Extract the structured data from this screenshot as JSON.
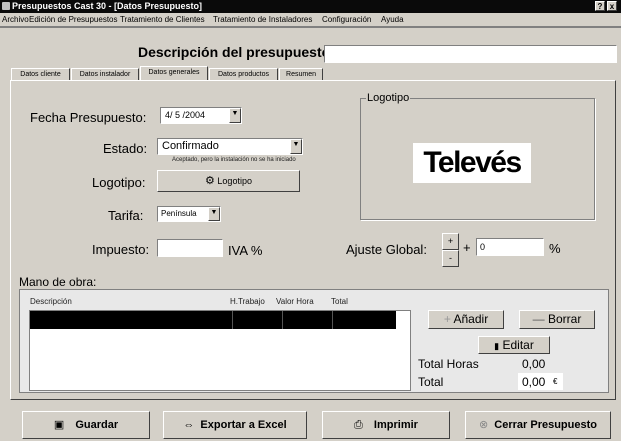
{
  "window": {
    "title": "Presupuestos Cast 30 - [Datos Presupuesto]",
    "help_btn": "?",
    "close_btn": "x"
  },
  "menu": [
    "Archivo",
    "Edición de Presupuestos",
    "Tratamiento de Clientes",
    "Tratamiento de Instaladores",
    "Configuración",
    "Ayuda"
  ],
  "descripcion": {
    "label": "Descripción del presupuesto:",
    "value": ""
  },
  "tabs": [
    "Datos cliente",
    "Datos instalador",
    "Datos generales",
    "Datos productos",
    "Resumen"
  ],
  "active_tab": "Datos generales",
  "form": {
    "fecha_label": "Fecha Presupuesto:",
    "fecha_value": "4/ 5 /2004",
    "estado_label": "Estado:",
    "estado_value": "Confirmado",
    "estado_note": "Aceptado, pero la instalación no se ha iniciado",
    "logotipo_label": "Logotipo:",
    "logotipo_button": "Logotipo",
    "tarifa_label": "Tarifa:",
    "tarifa_value": "Península",
    "impuesto_label": "Impuesto:",
    "impuesto_value": "",
    "iva_label": "IVA %",
    "ajuste_label": "Ajuste Global:",
    "ajuste_plus": "+",
    "ajuste_minus": "-",
    "ajuste_sign": "+",
    "ajuste_value": "0",
    "ajuste_pct": "%"
  },
  "logo_group": {
    "title": "Logotipo",
    "brand": "Televés"
  },
  "mano_obra": {
    "title": "Mano de obra:",
    "columns": [
      "Descripción",
      "H.Trabajo",
      "Valor Hora",
      "Total"
    ],
    "anadir": "Añadir",
    "borrar": "Borrar",
    "editar": "Editar",
    "total_horas_label": "Total Horas",
    "total_horas_value": "0,00",
    "total_label": "Total",
    "total_value": "0,00",
    "currency": "€"
  },
  "footer": {
    "guardar": "Guardar",
    "exportar": "Exportar a Excel",
    "imprimir": "Imprimir",
    "cerrar": "Cerrar Presupuesto"
  }
}
